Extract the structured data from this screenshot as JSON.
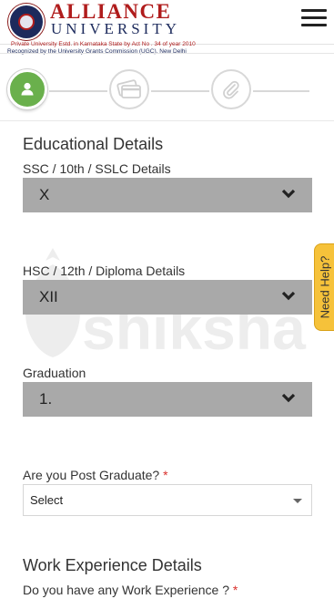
{
  "header": {
    "brand_name": "ALLIANCE",
    "brand_sub": "UNIVERSITY",
    "brand_line1": "Private University Estd. in Karnataka State by Act No . 34 of year 2010",
    "brand_line2": "Recognized by the University Grants Commission (UGC), New Delhi",
    "menu_icon": "hamburger-icon"
  },
  "stepper": {
    "steps": [
      {
        "icon": "user-icon",
        "state": "active"
      },
      {
        "icon": "credit-card-icon",
        "state": "pending"
      },
      {
        "icon": "paperclip-icon",
        "state": "pending"
      }
    ],
    "active_color": "#6ab04c"
  },
  "watermark": {
    "text": "shiksha"
  },
  "form": {
    "educational_title": "Educational Details",
    "ssc": {
      "label": "SSC / 10th / SSLC Details",
      "value": "X"
    },
    "hsc": {
      "label": "HSC / 12th / Diploma Details",
      "value": "XII"
    },
    "graduation": {
      "label": "Graduation",
      "value": "1."
    },
    "post_graduate": {
      "label": "Are you Post Graduate?",
      "required_mark": "*",
      "value": "Select"
    },
    "work_title": "Work Experience Details",
    "work_question": {
      "label": "Do you have any Work Experience ?",
      "required_mark": "*"
    }
  },
  "help_tab": {
    "label": "Need Help?",
    "color": "#f6c23a"
  }
}
